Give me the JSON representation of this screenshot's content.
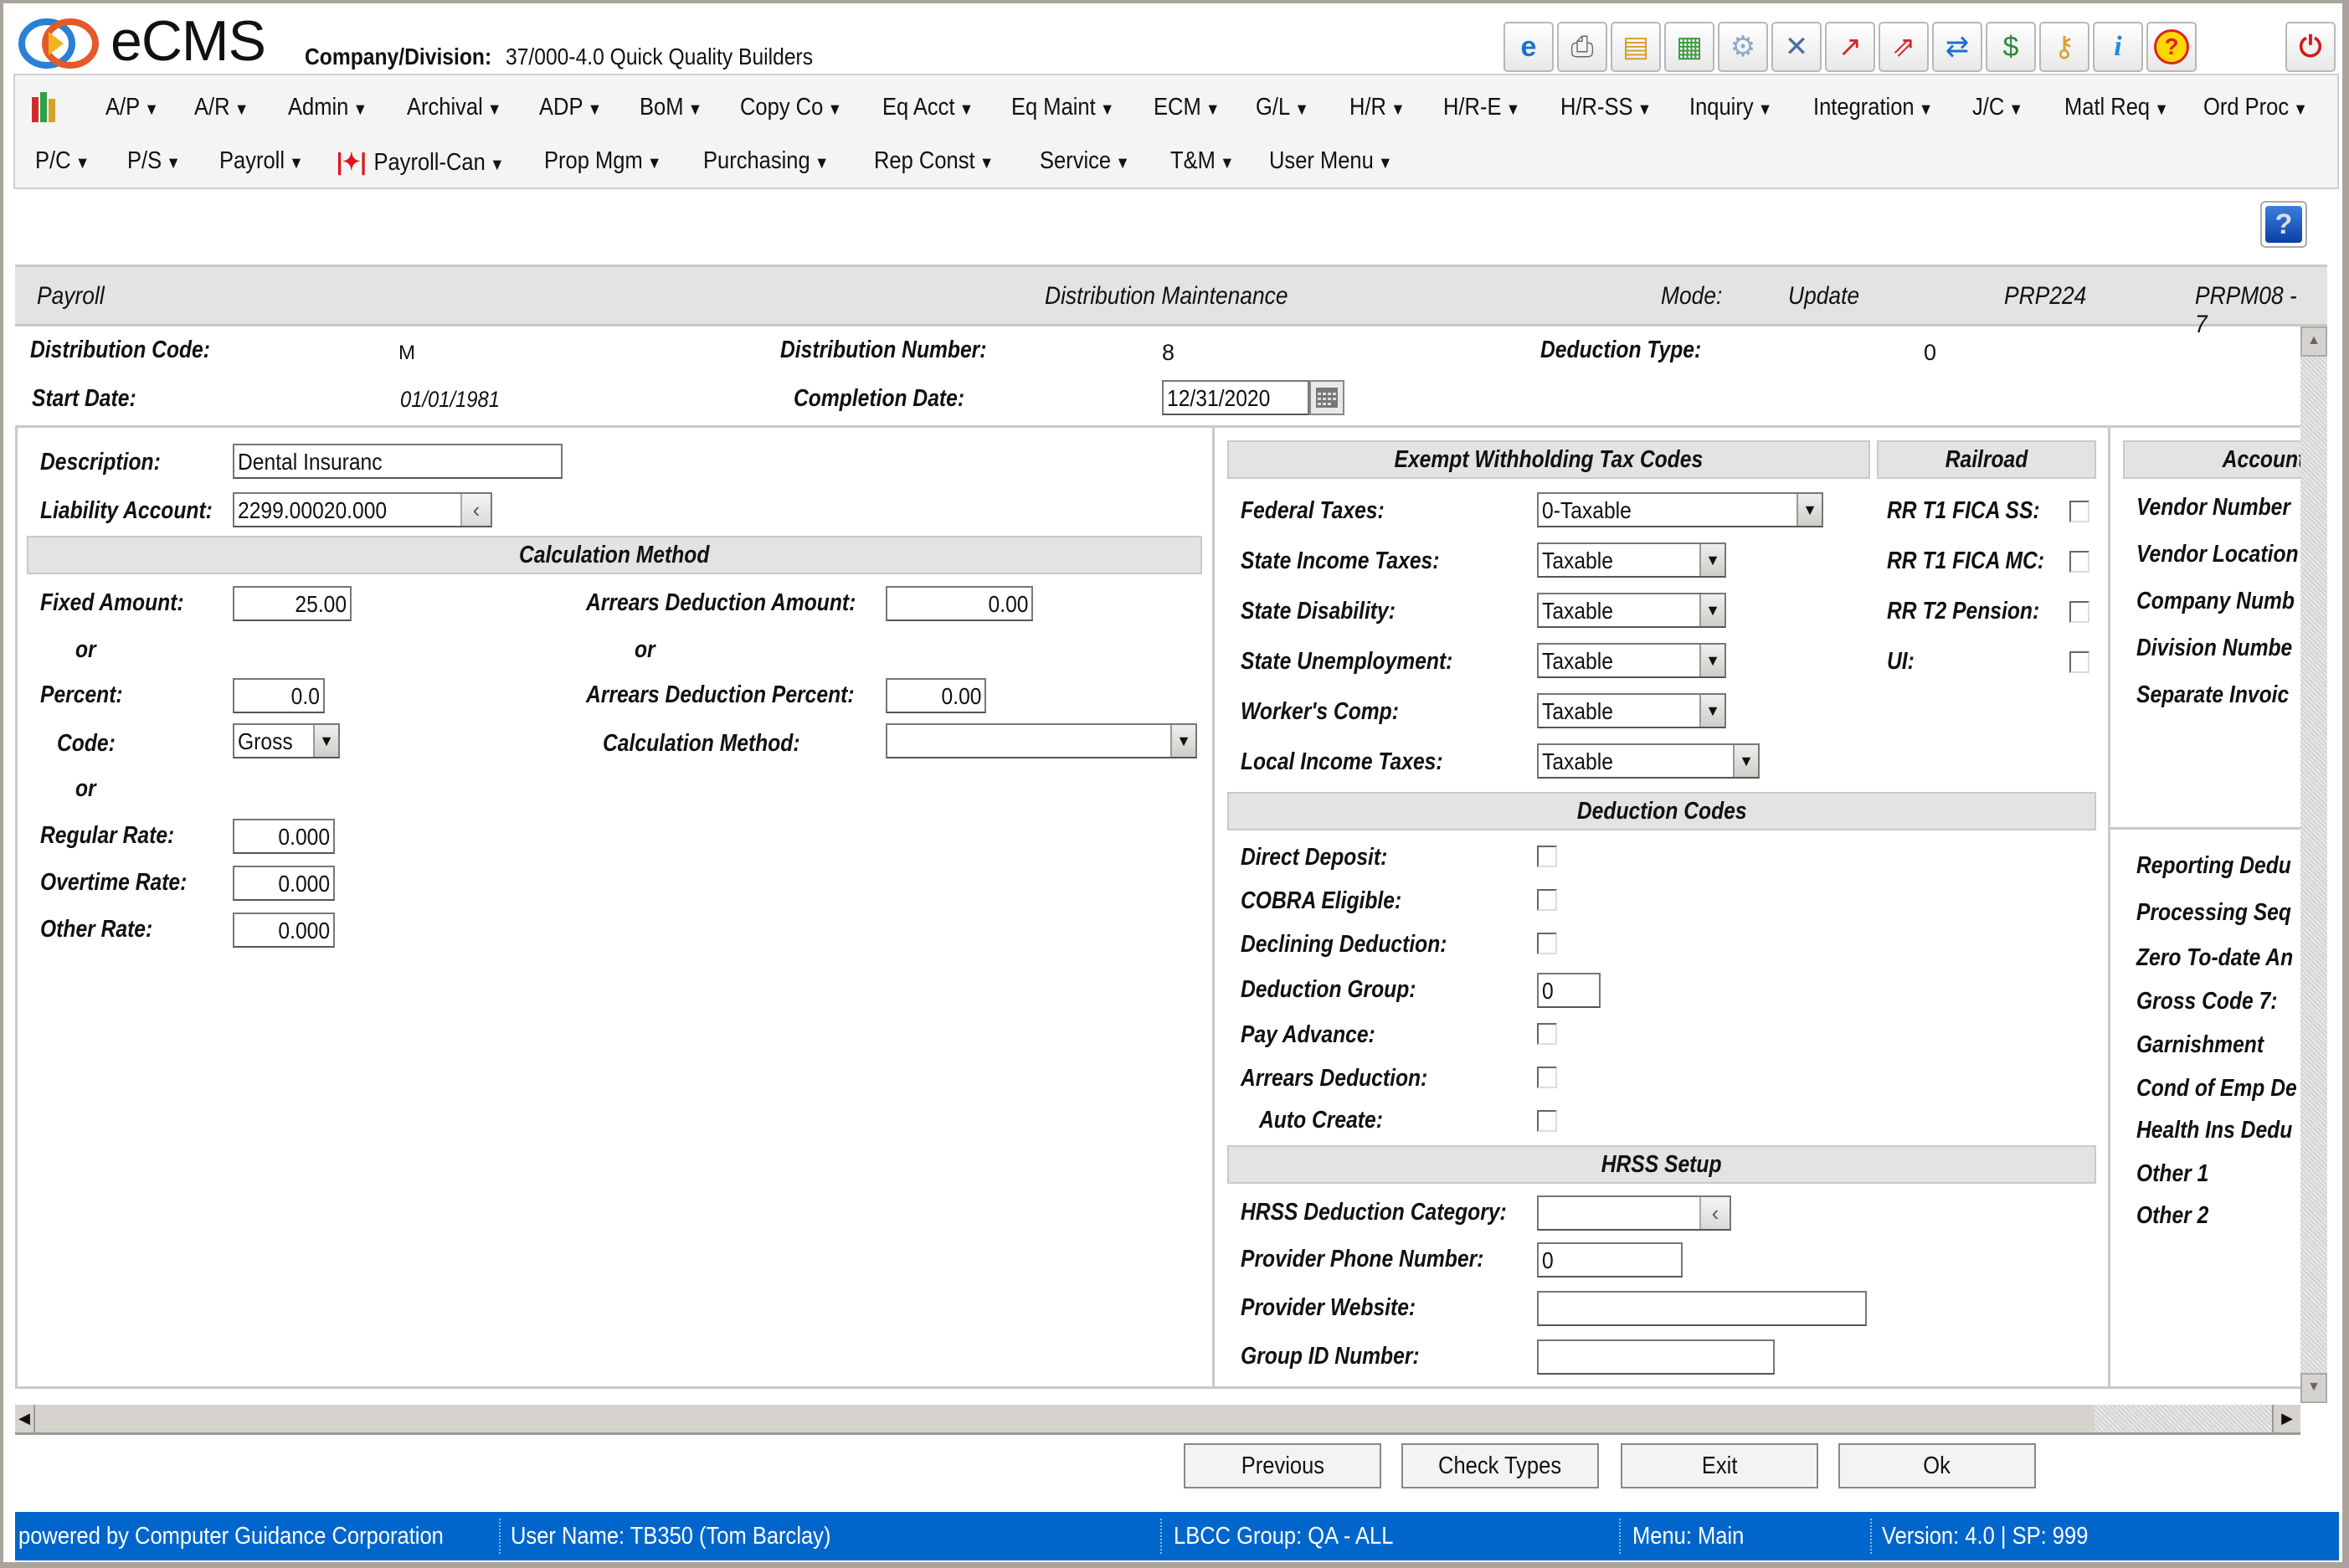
{
  "header": {
    "app_name": "eCMS",
    "company_label": "Company/Division:",
    "company_value": "37/000-4.0 Quick Quality Builders",
    "toolbar_icons": [
      "ecms-search-icon",
      "print-icon",
      "file-cabinet-icon",
      "schedule-grid-icon",
      "settings-gear-icon",
      "tools-icon",
      "trend-chart-icon",
      "trend-compare-icon",
      "refresh-arrows-icon",
      "transfer-window-icon",
      "keys-lock-icon",
      "info-icon",
      "help-icon",
      "power-icon"
    ]
  },
  "menu": {
    "row1": [
      "A/P",
      "A/R",
      "Admin",
      "Archival",
      "ADP",
      "BoM",
      "Copy Co",
      "Eq Acct",
      "Eq Maint",
      "ECM",
      "G/L",
      "H/R",
      "H/R-E",
      "H/R-SS",
      "Inquiry",
      "Integration",
      "J/C",
      "Matl Req",
      "Ord Proc"
    ],
    "row2": [
      "P/C",
      "P/S",
      "Payroll",
      "Payroll-Can",
      "Prop Mgm",
      "Purchasing",
      "Rep Const",
      "Service",
      "T&M",
      "User Menu"
    ]
  },
  "title_band": {
    "module": "Payroll",
    "screen": "Distribution Maintenance",
    "mode_label": "Mode:",
    "mode_value": "Update",
    "program": "PRP224",
    "map": "PRPM08 - 7"
  },
  "top_fields": {
    "distribution_code_label": "Distribution Code:",
    "distribution_code": "M",
    "distribution_number_label": "Distribution Number:",
    "distribution_number": "8",
    "deduction_type_label": "Deduction Type:",
    "deduction_type": "0",
    "start_date_label": "Start Date:",
    "start_date": "01/01/1981",
    "completion_date_label": "Completion Date:",
    "completion_date": "12/31/2020"
  },
  "left": {
    "description_label": "Description:",
    "description": "Dental Insuranc",
    "liability_account_label": "Liability Account:",
    "liability_account": "2299.00020.000",
    "calc_header": "Calculation Method",
    "fixed_amount_label": "Fixed Amount:",
    "fixed_amount": "25.00",
    "or": "or",
    "percent_label": "Percent:",
    "percent": "0.0",
    "code_label": "Code:",
    "code": "Gross",
    "regular_rate_label": "Regular Rate:",
    "regular_rate": "0.000",
    "overtime_rate_label": "Overtime Rate:",
    "overtime_rate": "0.000",
    "other_rate_label": "Other Rate:",
    "other_rate": "0.000",
    "arrears_amount_label": "Arrears Deduction Amount:",
    "arrears_amount": "0.00",
    "arrears_percent_label": "Arrears Deduction Percent:",
    "arrears_percent": "0.00",
    "calc_method_label": "Calculation Method:",
    "calc_method": ""
  },
  "exempt": {
    "header": "Exempt Withholding Tax Codes",
    "rows": [
      {
        "label": "Federal Taxes:",
        "value": "0-Taxable"
      },
      {
        "label": "State Income Taxes:",
        "value": "Taxable"
      },
      {
        "label": "State Disability:",
        "value": "Taxable"
      },
      {
        "label": "State Unemployment:",
        "value": "Taxable"
      },
      {
        "label": "Worker's Comp:",
        "value": "Taxable"
      },
      {
        "label": "Local Income Taxes:",
        "value": "Taxable"
      }
    ]
  },
  "railroad": {
    "header": "Railroad",
    "rows": [
      {
        "label": "RR T1 FICA SS:",
        "checked": false
      },
      {
        "label": "RR T1 FICA MC:",
        "checked": false
      },
      {
        "label": "RR T2 Pension:",
        "checked": false
      },
      {
        "label": "UI:",
        "checked": false
      }
    ]
  },
  "deduction_codes": {
    "header": "Deduction Codes",
    "direct_deposit": "Direct Deposit:",
    "cobra": "COBRA Eligible:",
    "declining": "Declining Deduction:",
    "group_label": "Deduction Group:",
    "group_value": "0",
    "pay_advance": "Pay Advance:",
    "arrears": "Arrears Deduction:",
    "auto_create": "Auto Create:"
  },
  "hrss": {
    "header": "HRSS Setup",
    "category_label": "HRSS Deduction Category:",
    "category": "",
    "phone_label": "Provider Phone Number:",
    "phone": "0",
    "website_label": "Provider Website:",
    "website": "",
    "group_id_label": "Group ID Number:",
    "group_id": ""
  },
  "account": {
    "header": "Account",
    "rows_top": [
      "Vendor Number",
      "Vendor Location",
      "Company Numb",
      "Division Numbe",
      "Separate Invoic"
    ],
    "rows_bottom": [
      "Reporting Dedu",
      "Processing Seq",
      "Zero To-date An",
      "Gross Code 7:",
      "Garnishment",
      "Cond of Emp De",
      "Health Ins Dedu",
      "Other 1",
      "Other 2"
    ]
  },
  "buttons": {
    "previous": "Previous",
    "check_types": "Check Types",
    "exit": "Exit",
    "ok": "Ok"
  },
  "status": {
    "powered_by": "powered by Computer Guidance Corporation",
    "user": "User Name: TB350 (Tom Barclay)",
    "group": "LBCC Group: QA - ALL",
    "menu": "Menu: Main",
    "version": "Version: 4.0 | SP: 999"
  },
  "colors": {
    "status_bar": "#0066cc",
    "band": "#e3e3e3"
  }
}
